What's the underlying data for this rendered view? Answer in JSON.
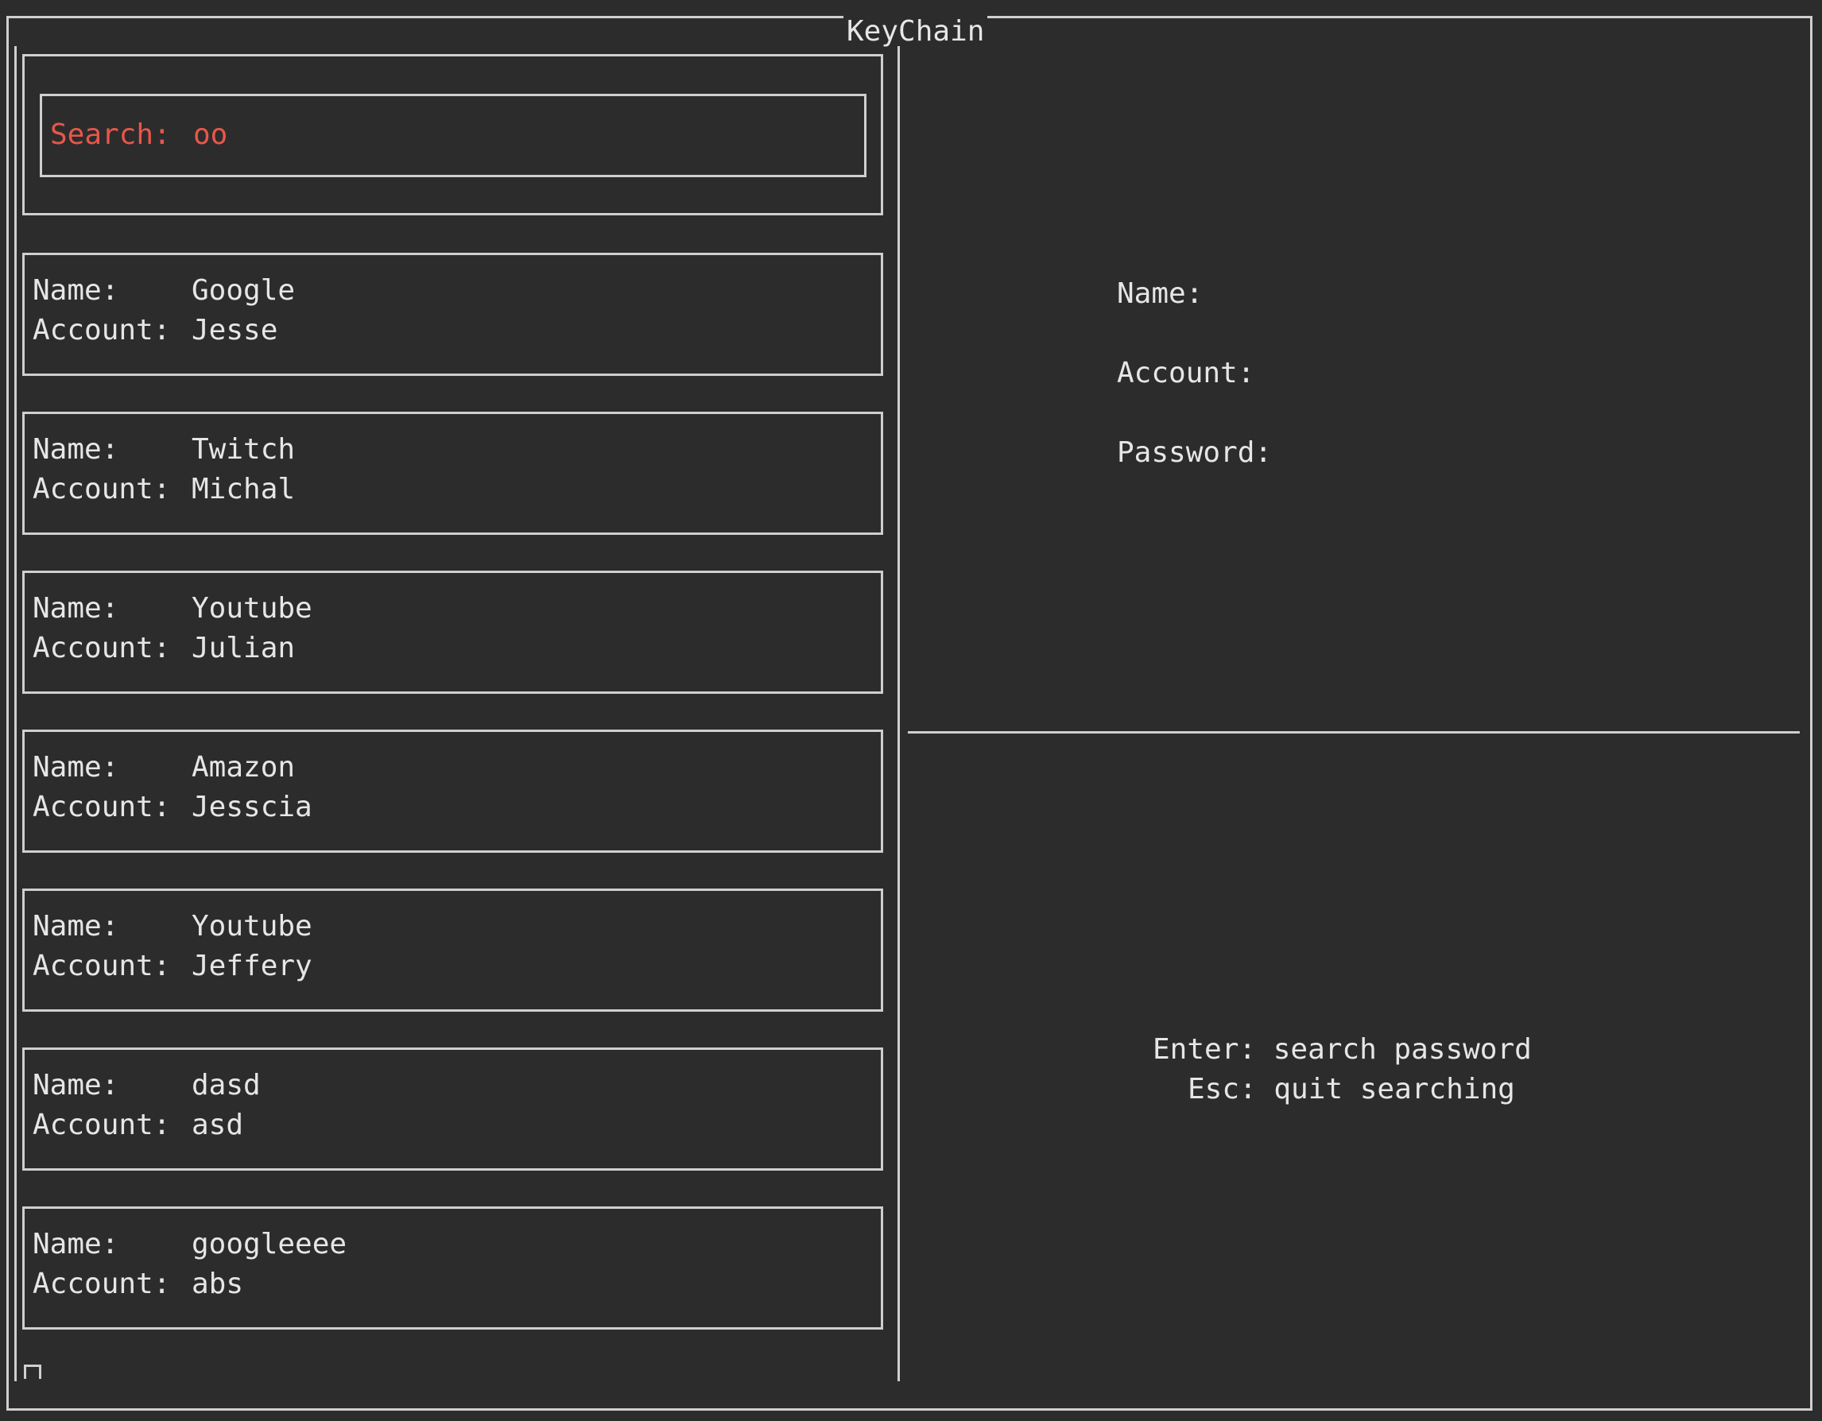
{
  "window": {
    "title": "KeyChain"
  },
  "search": {
    "label": "Search:",
    "value": "oo"
  },
  "entries": [
    {
      "name_label": "Name:",
      "name": "Google",
      "account_label": "Account:",
      "account": "Jesse"
    },
    {
      "name_label": "Name:",
      "name": "Twitch",
      "account_label": "Account:",
      "account": "Michal"
    },
    {
      "name_label": "Name:",
      "name": "Youtube",
      "account_label": "Account:",
      "account": "Julian"
    },
    {
      "name_label": "Name:",
      "name": "Amazon",
      "account_label": "Account:",
      "account": "Jesscia"
    },
    {
      "name_label": "Name:",
      "name": "Youtube",
      "account_label": "Account:",
      "account": "Jeffery"
    },
    {
      "name_label": "Name:",
      "name": "dasd",
      "account_label": "Account:",
      "account": "asd"
    },
    {
      "name_label": "Name:",
      "name": "googleeee",
      "account_label": "Account:",
      "account": "abs"
    }
  ],
  "details": {
    "name_label": "Name:",
    "account_label": "Account:",
    "password_label": "Password:"
  },
  "help": {
    "line1": "Enter: search password",
    "line2": "Esc: quit searching"
  },
  "colors": {
    "background": "#2c2c2c",
    "text": "#e6e6e6",
    "border": "#cfcfcf",
    "search_accent": "#e8574a"
  }
}
